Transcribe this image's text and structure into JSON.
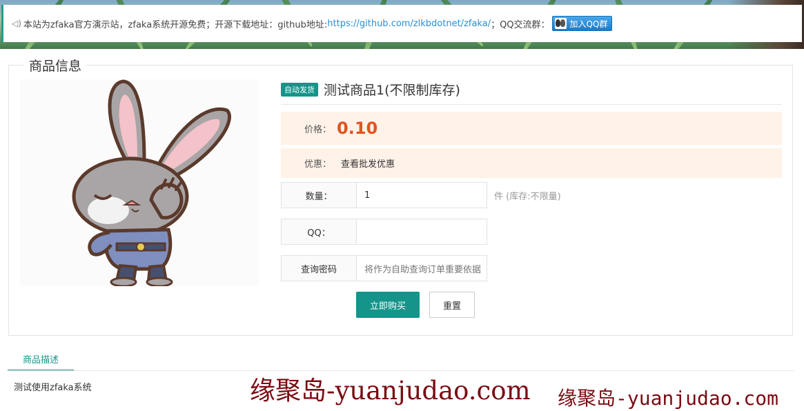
{
  "notice": {
    "text_prefix": "本站为zfaka官方演示站，zfaka系统开源免费；开源下载地址：github地址:",
    "link": "https://github.com/zlkbdotnet/zfaka/",
    "text_suffix": "；QQ交流群：",
    "qq_button": "加入QQ群"
  },
  "panel": {
    "legend": "商品信息"
  },
  "product": {
    "tag": "自动发货",
    "title": "测试商品1(不限制库存)",
    "price_label": "价格：",
    "price": "0.10",
    "promo_label": "优惠：",
    "promo_value": "查看批发优惠"
  },
  "form": {
    "quantity_label": "数量：",
    "quantity_value": "1",
    "quantity_hint": "件 (库存:不限量)",
    "qq_label": "QQ：",
    "qq_value": "",
    "password_label": "查询密码",
    "password_placeholder": "将作为自助查询订单重要依据"
  },
  "buttons": {
    "buy": "立即购买",
    "reset": "重置"
  },
  "tabs": {
    "description_tab": "商品描述",
    "description_text": "测试使用zfaka系统"
  },
  "watermark": {
    "large": "缘聚岛-yuanjudao.com",
    "small": "缘聚岛-yuanjudao.com"
  },
  "colors": {
    "accent": "#15948a",
    "price": "#e1531f",
    "price_bg": "#fff2e8",
    "link": "#2a8dd4",
    "watermark": "#7a0b12"
  }
}
